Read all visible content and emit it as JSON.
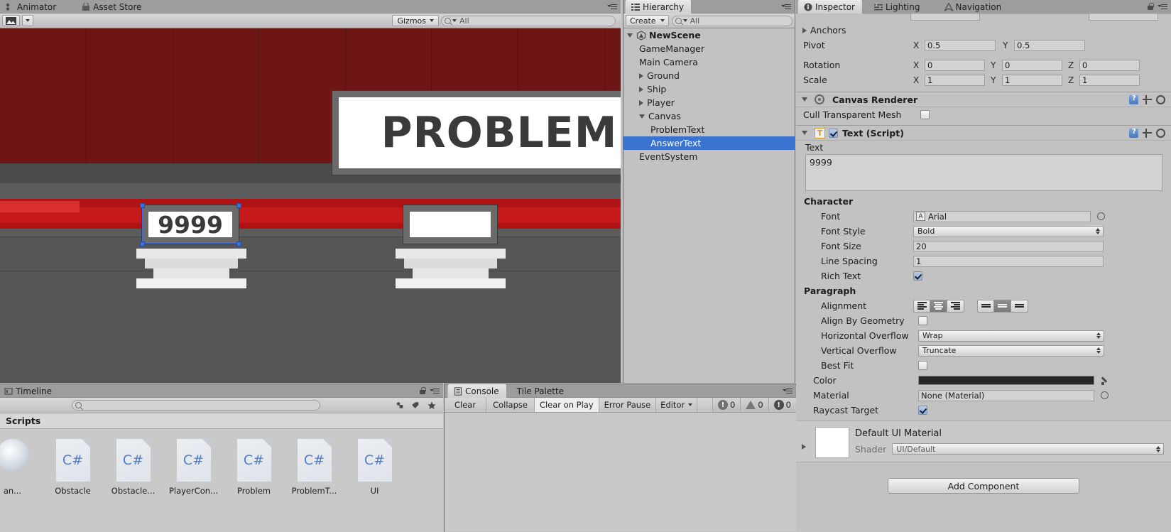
{
  "top_tabs": [
    {
      "label": "Animator",
      "icon": "animator-icon"
    },
    {
      "label": "Asset Store",
      "icon": "asset-store-icon"
    }
  ],
  "scene_toolbar": {
    "view_mode_label": "",
    "gizmos_label": "Gizmos",
    "search_placeholder": "All",
    "search_value": ""
  },
  "scene": {
    "problem_board_text": "PROBLEM",
    "answer_board_text": "9999",
    "answer_board2_text": ""
  },
  "hierarchy": {
    "tab_label": "Hierarchy",
    "create_label": "Create",
    "search_placeholder": "All",
    "search_value": "",
    "items": [
      {
        "label": "NewScene",
        "indent": 0,
        "expander": "down",
        "icon": "unity-scene-icon",
        "selected": false
      },
      {
        "label": "GameManager",
        "indent": 1,
        "expander": "none",
        "selected": false
      },
      {
        "label": "Main Camera",
        "indent": 1,
        "expander": "none",
        "selected": false
      },
      {
        "label": "Ground",
        "indent": 1,
        "expander": "right",
        "selected": false
      },
      {
        "label": "Ship",
        "indent": 1,
        "expander": "right",
        "selected": false
      },
      {
        "label": "Player",
        "indent": 1,
        "expander": "right",
        "selected": false
      },
      {
        "label": "Canvas",
        "indent": 1,
        "expander": "down",
        "selected": false
      },
      {
        "label": "ProblemText",
        "indent": 2,
        "expander": "none",
        "selected": false
      },
      {
        "label": "AnswerText",
        "indent": 2,
        "expander": "none",
        "selected": true
      },
      {
        "label": "EventSystem",
        "indent": 1,
        "expander": "none",
        "selected": false
      }
    ]
  },
  "inspector": {
    "tabs": [
      {
        "label": "Inspector",
        "icon": "info-icon",
        "active": true
      },
      {
        "label": "Lighting",
        "icon": "lighting-icon",
        "active": false
      },
      {
        "label": "Navigation",
        "icon": "navigation-icon",
        "active": false
      }
    ],
    "rect_transform": {
      "anchors_label": "Anchors",
      "pivot_label": "Pivot",
      "pivot_x_axis": "X",
      "pivot_x": "0.5",
      "pivot_y_axis": "Y",
      "pivot_y": "0.5",
      "rotation_label": "Rotation",
      "rot_x_axis": "X",
      "rot_x": "0",
      "rot_y_axis": "Y",
      "rot_y": "0",
      "rot_z_axis": "Z",
      "rot_z": "0",
      "scale_label": "Scale",
      "scale_x_axis": "X",
      "scale_x": "1",
      "scale_y_axis": "Y",
      "scale_y": "1",
      "scale_z_axis": "Z",
      "scale_z": "1"
    },
    "canvas_renderer": {
      "title": "Canvas Renderer",
      "cull_label": "Cull Transparent Mesh",
      "cull_checked": false
    },
    "text_script": {
      "title": "Text (Script)",
      "enabled": true,
      "text_label": "Text",
      "text_value": "9999",
      "character_label": "Character",
      "font_label": "Font",
      "font_value": "Arial",
      "font_style_label": "Font Style",
      "font_style_value": "Bold",
      "font_size_label": "Font Size",
      "font_size_value": "20",
      "line_spacing_label": "Line Spacing",
      "line_spacing_value": "1",
      "rich_text_label": "Rich Text",
      "rich_text_checked": true,
      "paragraph_label": "Paragraph",
      "alignment_label": "Alignment",
      "align_h_selected": 1,
      "align_v_selected": 1,
      "align_by_geometry_label": "Align By Geometry",
      "align_by_geometry_checked": false,
      "horizontal_overflow_label": "Horizontal Overflow",
      "horizontal_overflow_value": "Wrap",
      "vertical_overflow_label": "Vertical Overflow",
      "vertical_overflow_value": "Truncate",
      "best_fit_label": "Best Fit",
      "best_fit_checked": false,
      "color_label": "Color",
      "color_value": "#272727",
      "material_label": "Material",
      "material_value": "None (Material)",
      "raycast_target_label": "Raycast Target",
      "raycast_target_checked": true
    },
    "material_block": {
      "title": "Default UI Material",
      "shader_label": "Shader",
      "shader_value": "UI/Default"
    },
    "add_component_label": "Add Component"
  },
  "project": {
    "tab_label": "Timeline",
    "search_placeholder": "",
    "search_value": "",
    "breadcrumb": "Scripts",
    "assets": [
      {
        "label": "an...",
        "type": "gear"
      },
      {
        "label": "Obstacle",
        "type": "cs",
        "glyph": "C#"
      },
      {
        "label": "Obstacle...",
        "type": "cs",
        "glyph": "C#"
      },
      {
        "label": "PlayerCon...",
        "type": "cs",
        "glyph": "C#"
      },
      {
        "label": "Problem",
        "type": "cs",
        "glyph": "C#"
      },
      {
        "label": "ProblemT...",
        "type": "cs",
        "glyph": "C#"
      },
      {
        "label": "UI",
        "type": "cs",
        "glyph": "C#"
      }
    ]
  },
  "console": {
    "tabs": [
      {
        "label": "Console",
        "icon": "console-icon",
        "active": true
      },
      {
        "label": "Tile Palette",
        "icon": "",
        "active": false
      }
    ],
    "toolbar": {
      "clear_label": "Clear",
      "collapse_label": "Collapse",
      "clear_on_play_label": "Clear on Play",
      "error_pause_label": "Error Pause",
      "editor_label": "Editor"
    },
    "counts": {
      "errors": "0",
      "warnings": "0",
      "infos": "0"
    }
  }
}
